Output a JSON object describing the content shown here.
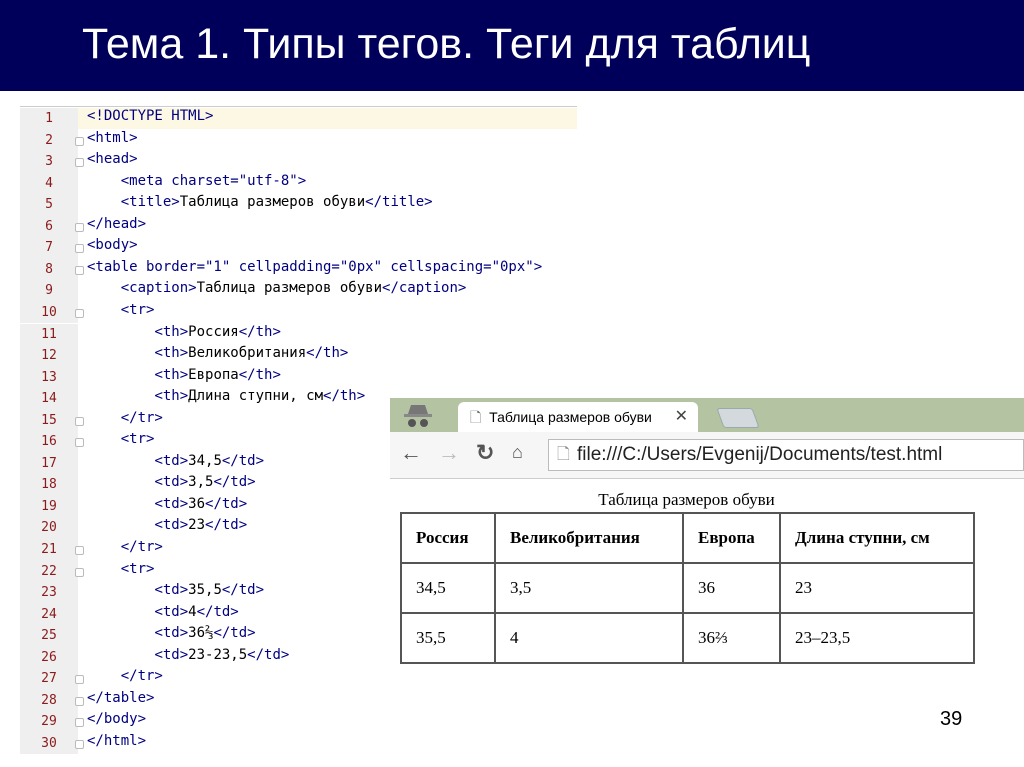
{
  "slide": {
    "title": "Тема 1. Типы тегов. Теги для таблиц",
    "page": "39"
  },
  "editor": {
    "lines": [
      "<!DOCTYPE HTML>",
      "<html>",
      "<head>",
      "    <meta charset=\"utf-8\">",
      "    <title>Таблица размеров обуви</title>",
      "</head>",
      "<body>",
      "<table border=\"1\" cellpadding=\"0px\" cellspacing=\"0px\">",
      "    <caption>Таблица размеров обуви</caption>",
      "    <tr>",
      "        <th>Россия</th>",
      "        <th>Великобритания</th>",
      "        <th>Европа</th>",
      "        <th>Длина ступни, см</th>",
      "    </tr>",
      "    <tr>",
      "        <td>34,5</td>",
      "        <td>3,5</td>",
      "        <td>36</td>",
      "        <td>23</td>",
      "    </tr>",
      "    <tr>",
      "        <td>35,5</td>",
      "        <td>4</td>",
      "        <td>36⅔</td>",
      "        <td>23-23,5</td>",
      "    </tr>",
      "</table>",
      "</body>",
      "</html>"
    ],
    "folds": [
      2,
      3,
      6,
      7,
      8,
      10,
      15,
      16,
      21,
      22,
      27,
      28,
      29,
      30
    ]
  },
  "browser": {
    "tab_title": "Таблица размеров обуви",
    "url": "file:///C:/Users/Evgenij/Documents/test.html",
    "caption": "Таблица размеров обуви",
    "headers": [
      "Россия",
      "Великобритания",
      "Европа",
      "Длина ступни, см"
    ],
    "rows": [
      [
        "34,5",
        "3,5",
        "36",
        "23"
      ],
      [
        "35,5",
        "4",
        "36⅔",
        "23–23,5"
      ]
    ]
  }
}
